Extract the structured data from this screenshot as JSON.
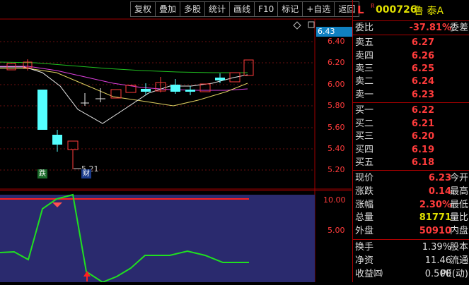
{
  "toolbar": [
    "复权",
    "叠加",
    "多股",
    "统计",
    "画线",
    "F10",
    "标记",
    "+自选",
    "返回"
  ],
  "header": {
    "market": "L",
    "flag": "R",
    "code": "000726",
    "name": "鲁 泰A"
  },
  "chart": {
    "current_price_tag": "6.43",
    "y_ticks": [
      "6.40",
      "6.20",
      "6.00",
      "5.80",
      "5.60",
      "5.40",
      "5.20"
    ],
    "low_marker": "5.21",
    "badge_die": "跌",
    "badge_cai": "财",
    "indicator_ticks": [
      "10.00",
      "5.00"
    ]
  },
  "quote": {
    "weibi": {
      "label": "委比",
      "value": "-37.81%",
      "right": "委差"
    },
    "sell": [
      {
        "label": "卖五",
        "price": "6.27"
      },
      {
        "label": "卖四",
        "price": "6.26"
      },
      {
        "label": "卖三",
        "price": "6.25"
      },
      {
        "label": "卖二",
        "price": "6.24"
      },
      {
        "label": "卖一",
        "price": "6.23"
      }
    ],
    "buy": [
      {
        "label": "买一",
        "price": "6.22"
      },
      {
        "label": "买二",
        "price": "6.21"
      },
      {
        "label": "买三",
        "price": "6.20"
      },
      {
        "label": "买四",
        "price": "6.19"
      },
      {
        "label": "买五",
        "price": "6.18"
      }
    ],
    "stats": [
      {
        "label": "现价",
        "value": "6.23",
        "right": "今开",
        "color": "#ff3b3b"
      },
      {
        "label": "涨跌",
        "value": "0.14",
        "right": "最高",
        "color": "#ff3b3b"
      },
      {
        "label": "涨幅",
        "value": "2.30%",
        "right": "最低",
        "color": "#ff3b3b"
      },
      {
        "label": "总量",
        "value": "81771",
        "right": "量比",
        "color": "#e0e000"
      },
      {
        "label": "外盘",
        "value": "50910",
        "right": "内盘",
        "color": "#ff3b3b"
      }
    ],
    "fund": [
      {
        "label": "换手",
        "value": "1.39%",
        "right": "股本"
      },
      {
        "label": "净资",
        "value": "11.46",
        "right": "流通"
      },
      {
        "label": "收益㈣",
        "value": "0.500",
        "right": "PE(动)"
      }
    ]
  },
  "colors": {
    "up": "#ff3b3b",
    "down": "#54ffff",
    "border": "#a00000"
  }
}
